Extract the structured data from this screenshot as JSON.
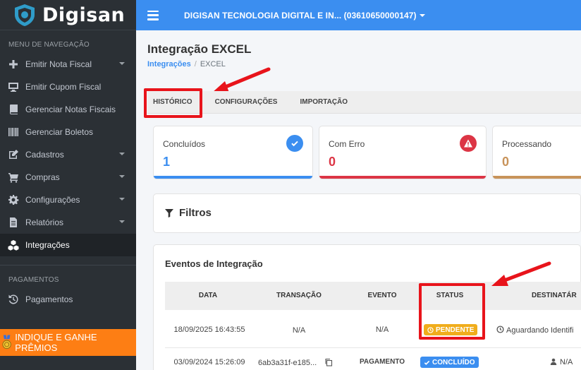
{
  "brand": {
    "name": "Digisan"
  },
  "sidebar": {
    "section_nav": "MENU DE NAVEGAÇÃO",
    "items": [
      {
        "label": "Emitir Nota Fiscal",
        "icon": "plus-icon",
        "has_caret": true
      },
      {
        "label": "Emitir Cupom Fiscal",
        "icon": "monitor-icon",
        "has_caret": false
      },
      {
        "label": "Gerenciar Notas Fiscais",
        "icon": "book-icon",
        "has_caret": false
      },
      {
        "label": "Gerenciar Boletos",
        "icon": "barcode-icon",
        "has_caret": false
      },
      {
        "label": "Cadastros",
        "icon": "edit-icon",
        "has_caret": true
      },
      {
        "label": "Compras",
        "icon": "cart-icon",
        "has_caret": true
      },
      {
        "label": "Configurações",
        "icon": "gear-icon",
        "has_caret": true
      },
      {
        "label": "Relatórios",
        "icon": "document-icon",
        "has_caret": true
      },
      {
        "label": "Integrações",
        "icon": "cubes-icon",
        "has_caret": false,
        "active": true
      }
    ],
    "section_payments": "PAGAMENTOS",
    "payments_item": {
      "label": "Pagamentos",
      "icon": "history-icon"
    },
    "promo": "INDIQUE E GANHE PRÊMIOS"
  },
  "topbar": {
    "company": "DIGISAN TECNOLOGIA DIGITAL E IN... (03610650000147)"
  },
  "page": {
    "title": "Integração EXCEL",
    "breadcrumb": {
      "link": "Integrações",
      "separator": "/",
      "current": "EXCEL"
    }
  },
  "tabs": [
    {
      "label": "HISTÓRICO",
      "active": true
    },
    {
      "label": "CONFIGURAÇÕES"
    },
    {
      "label": "IMPORTAÇÃO"
    }
  ],
  "stats": [
    {
      "label": "Concluídos",
      "value": "1",
      "color": "#3b8ef0",
      "icon": "check-circle-icon"
    },
    {
      "label": "Com Erro",
      "value": "0",
      "color": "#dc3545",
      "icon": "warning-icon"
    },
    {
      "label": "Processando",
      "value": "0",
      "color": "#c8935a"
    }
  ],
  "filters": {
    "title": "Filtros"
  },
  "events": {
    "title": "Eventos de Integração",
    "columns": [
      "DATA",
      "TRANSAÇÃO",
      "EVENTO",
      "STATUS",
      "DESTINATÁR"
    ],
    "rows": [
      {
        "data": "18/09/2025 16:43:55",
        "transacao": "N/A",
        "evento": "N/A",
        "status": "PENDENTE",
        "status_color": "#f0ad1c",
        "destinatario": "Aguardando Identifi"
      },
      {
        "data": "03/09/2024 15:26:09",
        "transacao": "6ab3a31f-e185...",
        "evento": "PAGAMENTO",
        "status": "CONCLUÍDO",
        "status_color": "#3b8ef0",
        "destinatario": "N/A"
      }
    ]
  },
  "colors": {
    "topbar": "#3b8ef0",
    "sidebar": "#2b3035",
    "promo": "#fd7e14",
    "annotation": "#e8141b"
  }
}
